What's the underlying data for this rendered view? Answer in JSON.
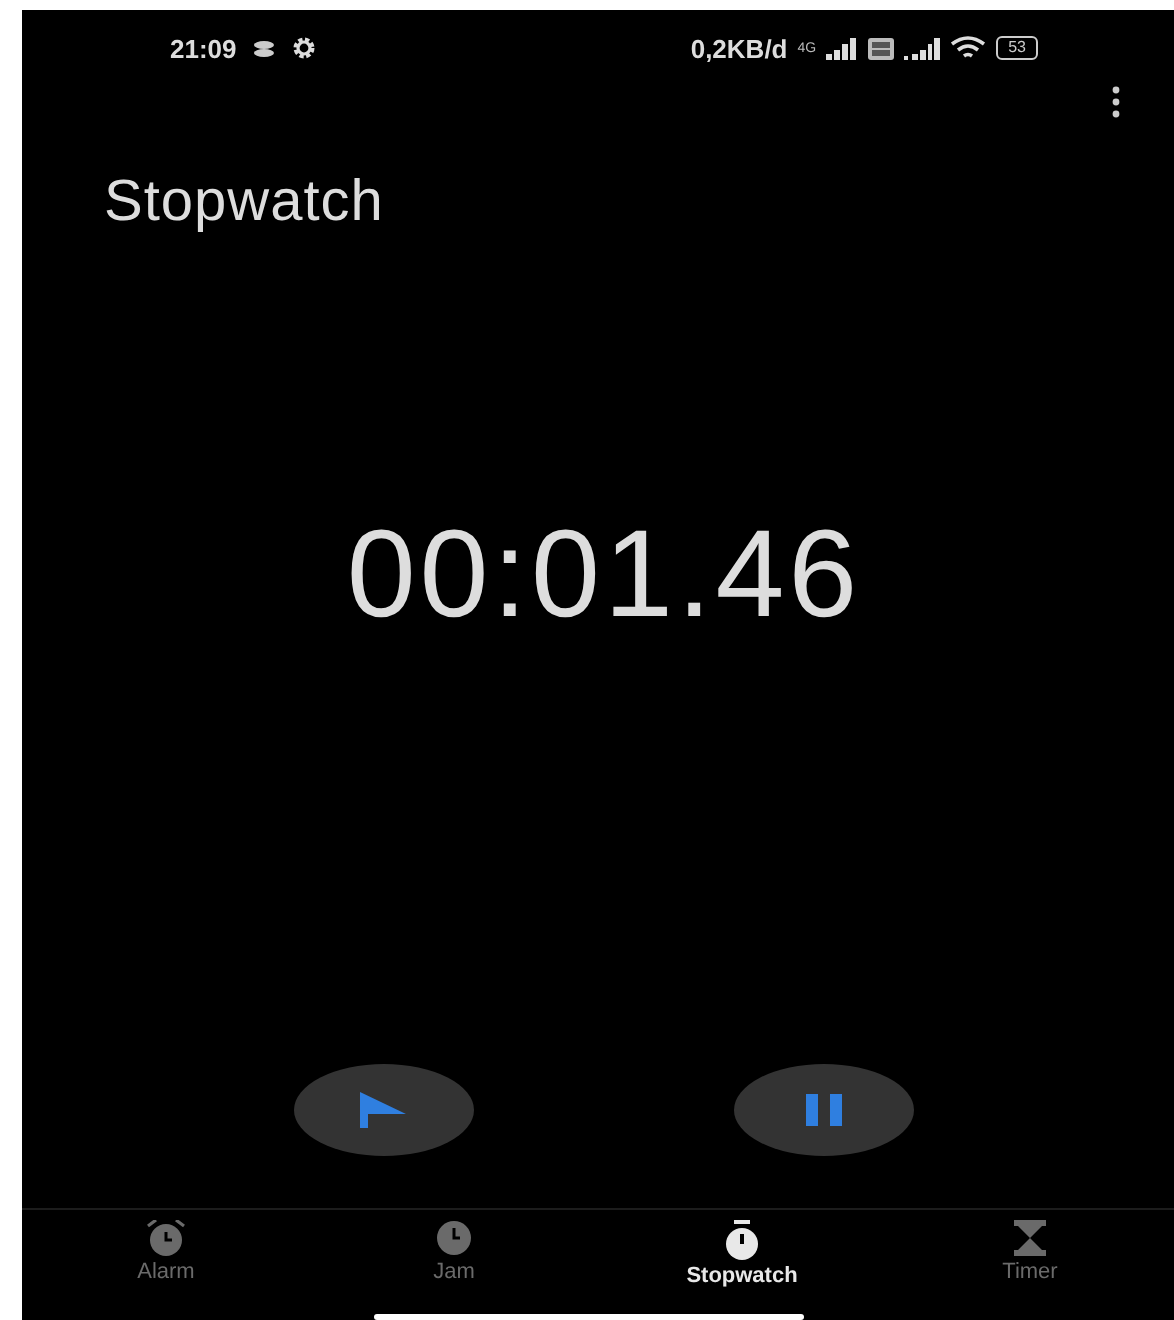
{
  "status_bar": {
    "time": "21:09",
    "data_rate": "0,2KB/d",
    "network": "4G",
    "battery": "53"
  },
  "title": "Stopwatch",
  "elapsed": "00:01.46",
  "controls": [
    {
      "kind": "lap"
    },
    {
      "kind": "pause"
    }
  ],
  "tabs": [
    {
      "label": "Alarm",
      "kind": "alarm",
      "selected": false
    },
    {
      "label": "Jam",
      "kind": "clock",
      "selected": false
    },
    {
      "label": "Stopwatch",
      "kind": "stopwatch",
      "selected": true
    },
    {
      "label": "Timer",
      "kind": "timer",
      "selected": false
    }
  ]
}
